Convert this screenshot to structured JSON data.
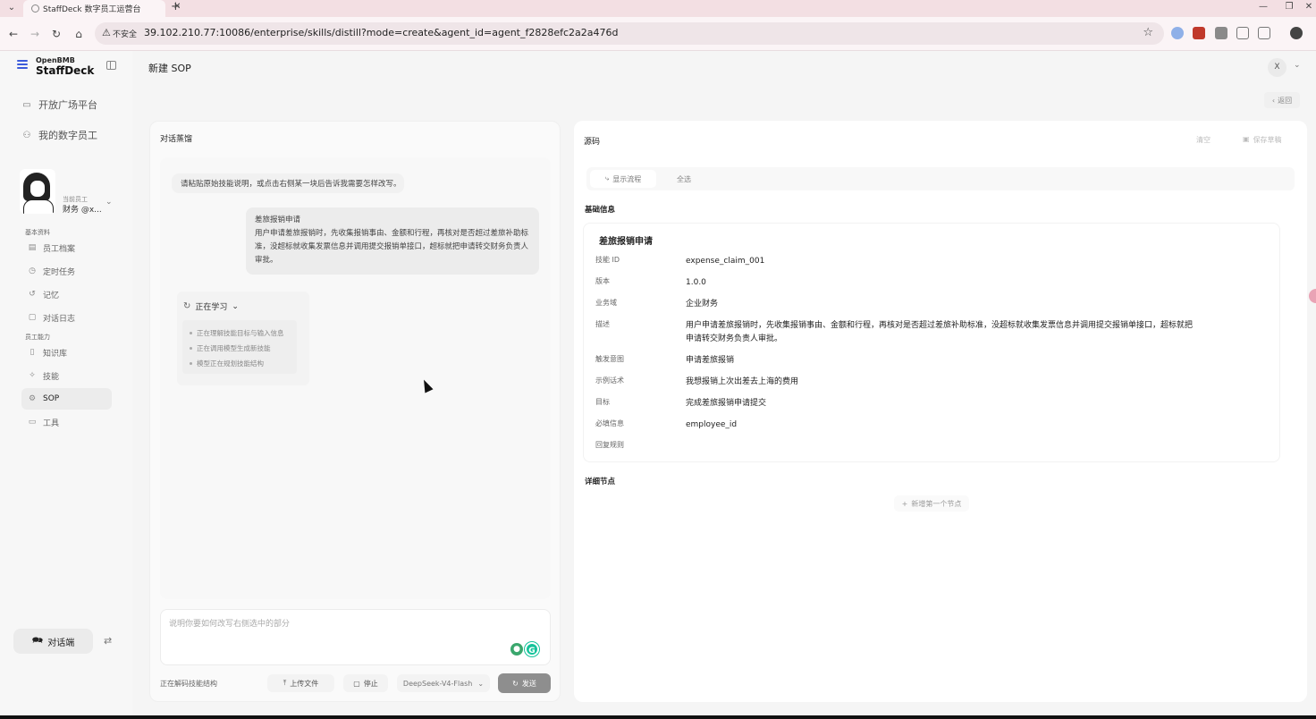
{
  "browser": {
    "tab_title": "StaffDeck 数字员工运营台",
    "insecure_label": "不安全",
    "url": "39.102.210.77:10086/enterprise/skills/distill?mode=create&agent_id=agent_f2828efc2a2a476d"
  },
  "brand": {
    "small": "OpenBMB",
    "big": "StaffDeck"
  },
  "sidebar": {
    "top_links": [
      {
        "label": "开放广场平台",
        "icon": "plaza-icon"
      },
      {
        "label": "我的数字员工",
        "icon": "users-icon"
      }
    ],
    "agent": {
      "role": "当前员工",
      "name": "财务 @x..."
    },
    "section_basic": "基本资料",
    "basic_items": [
      {
        "label": "员工档案",
        "icon": "profile-icon"
      },
      {
        "label": "定时任务",
        "icon": "clock-icon"
      },
      {
        "label": "记忆",
        "icon": "memory-icon"
      },
      {
        "label": "对话日志",
        "icon": "log-icon"
      }
    ],
    "section_ability": "员工能力",
    "ability_items": [
      {
        "label": "知识库",
        "icon": "book-icon"
      },
      {
        "label": "技能",
        "icon": "skill-icon"
      },
      {
        "label": "SOP",
        "icon": "sop-icon",
        "active": true
      },
      {
        "label": "工具",
        "icon": "tool-icon"
      }
    ],
    "chat_button": "对话端"
  },
  "header": {
    "title": "新建 SOP",
    "user_initial": "X",
    "back_label": "返回"
  },
  "chat": {
    "panel_title": "对话蒸馏",
    "bot_hint": "请粘贴原始技能说明，或点击右侧某一块后告诉我需要怎样改写。",
    "user_message_line1": "差旅报销申请",
    "user_message_body": "用户申请差旅报销时，先收集报销事由、金额和行程，再核对是否超过差旅补助标准，没超标就收集发票信息并调用提交报销单接口，超标就把申请转交财务负责人审批。",
    "learning_label": "正在学习",
    "learning_steps": [
      "正在理解技能目标与输入信息",
      "正在调用模型生成新技能",
      "模型正在规划技能结构"
    ],
    "input_placeholder": "说明你要如何改写右侧选中的部分",
    "status_text": "正在解码技能结构",
    "upload_label": "上传文件",
    "stop_label": "停止",
    "model_name": "DeepSeek-V4-Flash",
    "send_label": "发送"
  },
  "source": {
    "panel_title": "源码",
    "clear_label": "清空",
    "save_label": "保存草稿",
    "flow_label": "显示流程",
    "select_all_label": "全选",
    "basic_section": "基础信息",
    "skill_title": "差旅报销申请",
    "fields": [
      {
        "key": "技能 ID",
        "value": "expense_claim_001"
      },
      {
        "key": "版本",
        "value": "1.0.0"
      },
      {
        "key": "业务域",
        "value": "企业财务"
      },
      {
        "key": "描述",
        "value": "用户申请差旅报销时，先收集报销事由、金额和行程，再核对是否超过差旅补助标准，没超标就收集发票信息并调用提交报销单接口，超标就把申请转交财务负责人审批。"
      },
      {
        "key": "触发意图",
        "value": "申请差旅报销"
      },
      {
        "key": "示例话术",
        "value": "我想报销上次出差去上海的费用"
      },
      {
        "key": "目标",
        "value": "完成差旅报销申请提交"
      },
      {
        "key": "必填信息",
        "value": "employee_id"
      },
      {
        "key": "回复规则",
        "value": ""
      }
    ],
    "nodes_section": "详细节点",
    "add_node_label": "新增第一个节点"
  }
}
